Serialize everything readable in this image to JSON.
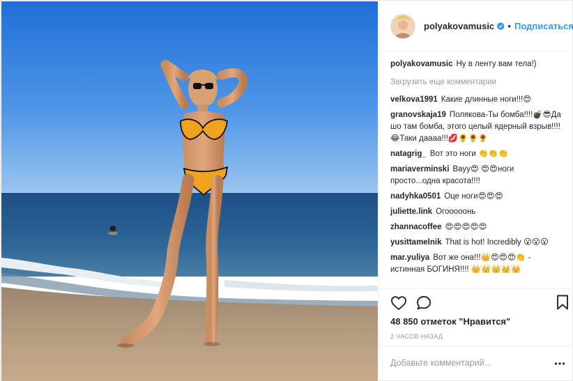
{
  "post": {
    "username": "polyakovamusic",
    "separator": "•",
    "follow_label": "Подписаться",
    "load_more_label": "Загрузить еще комментарии",
    "caption": {
      "author": "polyakovamusic",
      "text": "Ну в ленту вам тела!)"
    },
    "comments": [
      {
        "author": "velkova1991",
        "text": "Какие длинные ноги!!!😍"
      },
      {
        "author": "granovskaja19",
        "text": "Полякова-Ты бомба!!!!💣😎Да шо там бомба, этого целый ядерный взрыв!!!!😂Таки даааа!!!💋🌻🌻🌻"
      },
      {
        "author": "natagrig_",
        "text": "Вот это ноги 👏👏👏"
      },
      {
        "author": "mariaverminski",
        "text": "Вауу😍 😍😍ноги просто...одна красота!!!!"
      },
      {
        "author": "nadyhka0501",
        "text": "Оце ноги😍😍😍"
      },
      {
        "author": "juliette.link",
        "text": "Огооооонь"
      },
      {
        "author": "zhannacoffee",
        "text": "😍😍😍😍😍"
      },
      {
        "author": "yusittamelnik",
        "text": "That is hot! Incredibly 😮😮😮"
      },
      {
        "author": "mar.yuliya",
        "text": "Вот же она!!!👑😍😍😍👏 - истинная БОГИНЯ!!!! 👑👑👑👑👑"
      }
    ],
    "likes_text": "48 850 отметок \"Нравится\"",
    "time_text": "2 ЧАСОВ НАЗАД",
    "comment_placeholder": "Добавьте комментарий...",
    "colors": {
      "link": "#3897f0",
      "text": "#262626",
      "muted": "#999999",
      "border": "#efefef"
    },
    "icons": {
      "like": "heart-outline-icon",
      "comment": "speech-bubble-icon",
      "save": "bookmark-icon",
      "more": "more-options-icon",
      "verified": "verified-badge-icon"
    }
  }
}
